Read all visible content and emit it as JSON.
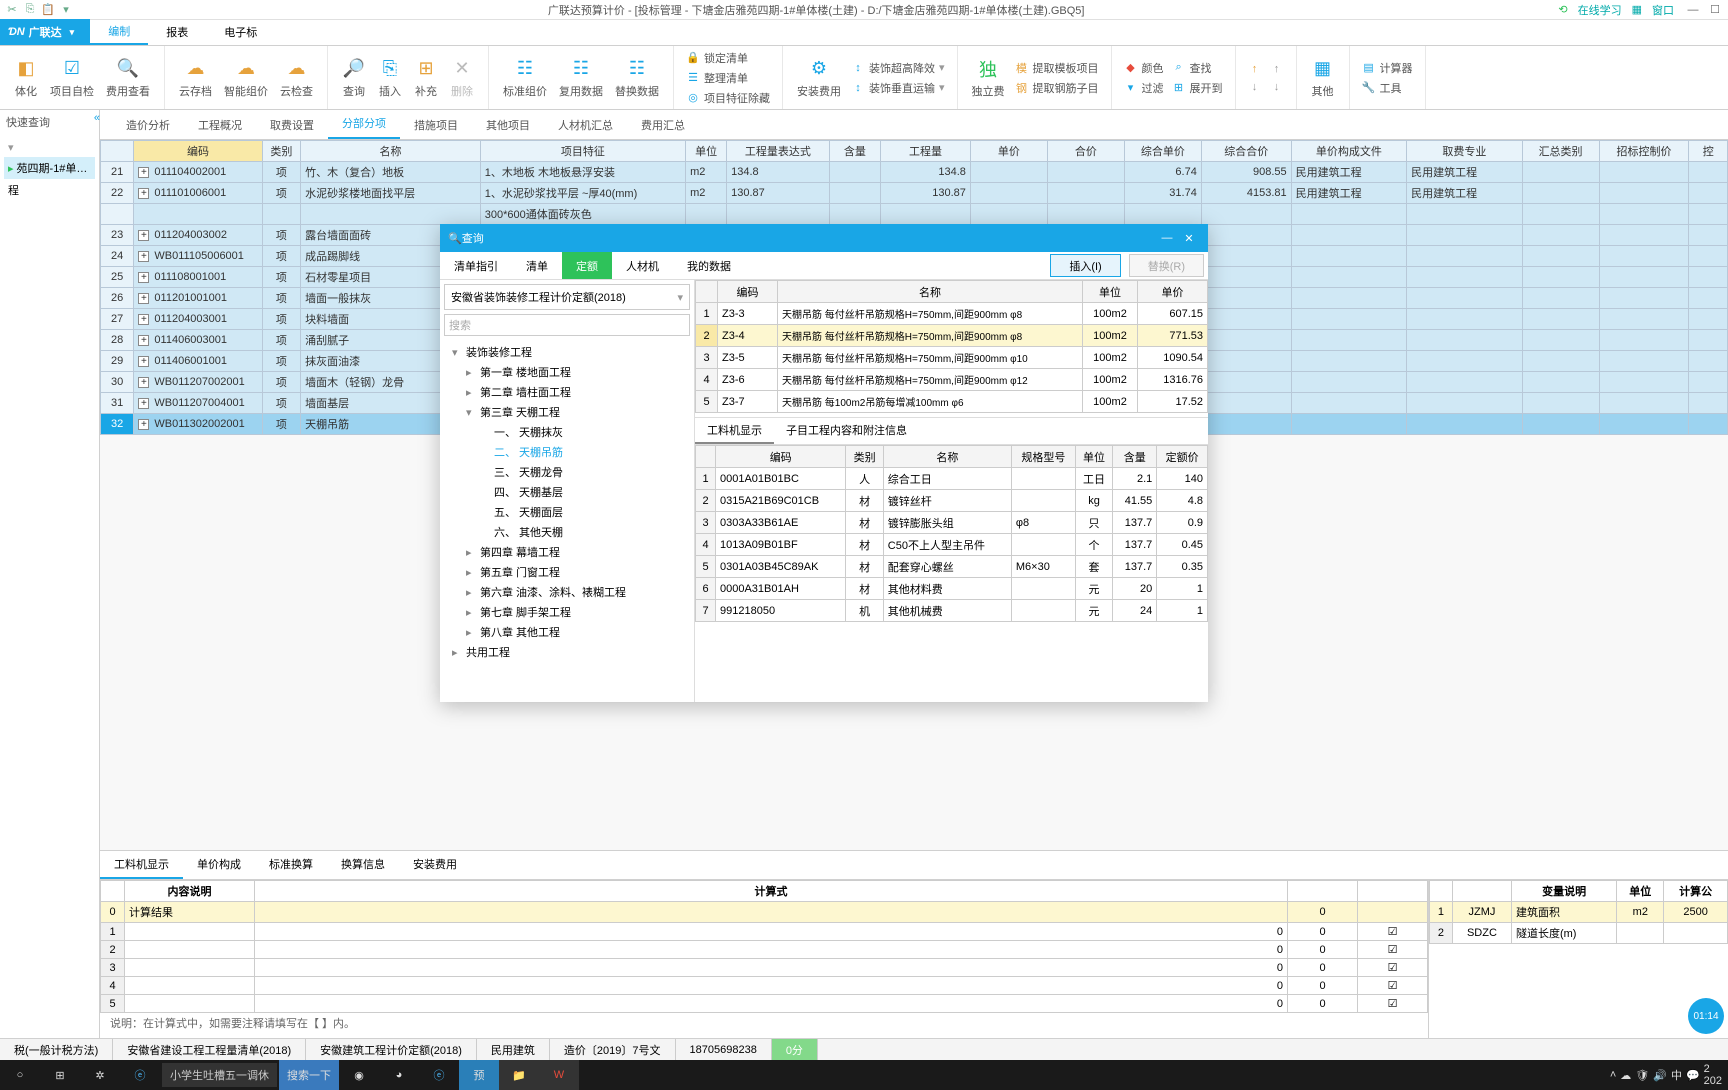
{
  "titlebar": {
    "title": "广联达预算计价 - [投标管理 - 下塘金店雅苑四期-1#单体楼(土建) - D:/下塘金店雅苑四期-1#单体楼(土建).GBQ5]",
    "online_study": "在线学习",
    "window": "窗口"
  },
  "brand": "广联达",
  "menus": [
    "编制",
    "报表",
    "电子标"
  ],
  "menu_active": 0,
  "ribbon_big": [
    {
      "label": "体化"
    },
    {
      "label": "项目自检"
    },
    {
      "label": "费用查看"
    },
    {
      "label": "云存档"
    },
    {
      "label": "智能组价"
    },
    {
      "label": "云检查"
    },
    {
      "label": "查询"
    },
    {
      "label": "插入"
    },
    {
      "label": "补充"
    },
    {
      "label": "删除",
      "disabled": true
    },
    {
      "label": "标准组价"
    },
    {
      "label": "复用数据"
    },
    {
      "label": "替换数据"
    },
    {
      "label": ""
    },
    {
      "label": "安装费用"
    },
    {
      "label": ""
    },
    {
      "label": "独立费"
    },
    {
      "label": ""
    },
    {
      "label": ""
    },
    {
      "label": ""
    },
    {
      "label": ""
    },
    {
      "label": "其他"
    },
    {
      "label": ""
    }
  ],
  "ribbon_stack1": [
    "锁定清单",
    "整理清单",
    "项目特征除藏"
  ],
  "ribbon_stack2": [
    "装饰超高降效",
    "装饰垂直运输"
  ],
  "ribbon_stack3": [
    "提取模板项目",
    "提取钢筋子目"
  ],
  "ribbon_stack4": [
    "颜色",
    "过滤"
  ],
  "ribbon_stack4b": [
    "查找",
    "展开到"
  ],
  "ribbon_stack5": [
    "计算器",
    "工具"
  ],
  "left_panel": {
    "header": "快速查询",
    "items": [
      "苑四期-1#单…",
      "程"
    ]
  },
  "nav_tabs": [
    "造价分析",
    "工程概况",
    "取费设置",
    "分部分项",
    "措施项目",
    "其他项目",
    "人材机汇总",
    "费用汇总"
  ],
  "nav_active": 3,
  "main_cols": [
    "",
    "编码",
    "类别",
    "名称",
    "项目特征",
    "单位",
    "工程量表达式",
    "含量",
    "工程量",
    "单价",
    "合价",
    "综合单价",
    "综合合价",
    "单价构成文件",
    "取费专业",
    "汇总类别",
    "招标控制价",
    "控"
  ],
  "rows": [
    {
      "n": "21",
      "code": "011104002001",
      "cat": "项",
      "name": "竹、木（复合）地板",
      "feat": "1、木地板 木地板悬浮安装",
      "unit": "m2",
      "expr": "134.8",
      "qty": "134.8",
      "up": "",
      "tot": "",
      "zup": "6.74",
      "ztot": "908.55",
      "file": "民用建筑工程",
      "spec": "民用建筑工程"
    },
    {
      "n": "22",
      "code": "011101006001",
      "cat": "项",
      "name": "水泥砂浆楼地面找平层",
      "feat": "1、水泥砂浆找平层 ~厚40(mm)",
      "unit": "m2",
      "expr": "130.87",
      "qty": "130.87",
      "up": "",
      "tot": "",
      "zup": "31.74",
      "ztot": "4153.81",
      "file": "民用建筑工程",
      "spec": "民用建筑工程"
    },
    {
      "n": "",
      "code": "",
      "cat": "",
      "name": "",
      "feat": "300*600通体面砖灰色",
      "unit": "",
      "expr": "",
      "qty": "",
      "up": "",
      "tot": "",
      "zup": "",
      "ztot": "",
      "file": "",
      "spec": ""
    },
    {
      "n": "23",
      "code": "011204003002",
      "cat": "项",
      "name": "露台墙面面砖",
      "feat": "",
      "unit": "",
      "expr": "",
      "qty": "",
      "up": "",
      "tot": "",
      "zup": "",
      "ztot": "",
      "file": "",
      "spec": ""
    },
    {
      "n": "24",
      "code": "WB011105006001",
      "cat": "项",
      "name": "成品踢脚线",
      "feat": "",
      "unit": "",
      "expr": "",
      "qty": "",
      "up": "",
      "tot": "",
      "zup": "",
      "ztot": "",
      "file": "",
      "spec": ""
    },
    {
      "n": "25",
      "code": "011108001001",
      "cat": "项",
      "name": "石材零星项目",
      "feat": "",
      "unit": "",
      "expr": "",
      "qty": "",
      "up": "",
      "tot": "",
      "zup": "",
      "ztot": "",
      "file": "",
      "spec": ""
    },
    {
      "n": "26",
      "code": "011201001001",
      "cat": "项",
      "name": "墙面一般抹灰",
      "feat": "",
      "unit": "",
      "expr": "",
      "qty": "",
      "up": "",
      "tot": "",
      "zup": "",
      "ztot": "",
      "file": "",
      "spec": ""
    },
    {
      "n": "27",
      "code": "011204003001",
      "cat": "项",
      "name": "块料墙面",
      "feat": "",
      "unit": "",
      "expr": "",
      "qty": "",
      "up": "",
      "tot": "",
      "zup": "",
      "ztot": "",
      "file": "",
      "spec": ""
    },
    {
      "n": "28",
      "code": "011406003001",
      "cat": "项",
      "name": "涌刮腻子",
      "feat": "",
      "unit": "",
      "expr": "",
      "qty": "",
      "up": "",
      "tot": "",
      "zup": "",
      "ztot": "",
      "file": "",
      "spec": ""
    },
    {
      "n": "29",
      "code": "011406001001",
      "cat": "项",
      "name": "抹灰面油漆",
      "feat": "",
      "unit": "",
      "expr": "",
      "qty": "",
      "up": "",
      "tot": "",
      "zup": "",
      "ztot": "",
      "file": "",
      "spec": ""
    },
    {
      "n": "30",
      "code": "WB011207002001",
      "cat": "项",
      "name": "墙面木（轻钢）龙骨",
      "feat": "",
      "unit": "",
      "expr": "",
      "qty": "",
      "up": "",
      "tot": "",
      "zup": "",
      "ztot": "",
      "file": "",
      "spec": ""
    },
    {
      "n": "31",
      "code": "WB011207004001",
      "cat": "项",
      "name": "墙面基层",
      "feat": "",
      "unit": "",
      "expr": "",
      "qty": "",
      "up": "",
      "tot": "",
      "zup": "",
      "ztot": "",
      "file": "",
      "spec": ""
    },
    {
      "n": "32",
      "code": "WB011302002001",
      "cat": "项",
      "name": "天棚吊筋",
      "feat": "",
      "unit": "",
      "expr": "",
      "qty": "",
      "up": "",
      "tot": "",
      "zup": "",
      "ztot": "",
      "file": "",
      "spec": "",
      "sel": true
    }
  ],
  "bottom_tabs": [
    "工料机显示",
    "单价构成",
    "标准换算",
    "换算信息",
    "安装费用"
  ],
  "calc_cols": [
    "",
    "内容说明",
    "计算式",
    "",
    ""
  ],
  "calc_rows": [
    {
      "n": "0",
      "a": "计算结果",
      "b": "",
      "c": "0",
      "d": "",
      "yell": true
    },
    {
      "n": "1",
      "a": "",
      "b": "0",
      "c": "0",
      "d": "☑"
    },
    {
      "n": "2",
      "a": "",
      "b": "0",
      "c": "0",
      "d": "☑"
    },
    {
      "n": "3",
      "a": "",
      "b": "0",
      "c": "0",
      "d": "☑"
    },
    {
      "n": "4",
      "a": "",
      "b": "0",
      "c": "0",
      "d": "☑"
    },
    {
      "n": "5",
      "a": "",
      "b": "0",
      "c": "0",
      "d": "☑"
    }
  ],
  "hint": "说明：在计算式中，如需要注释请填写在【 】内。",
  "vars_cols": [
    "",
    "",
    "变量说明",
    "单位",
    "计算公"
  ],
  "vars_rows": [
    {
      "n": "1",
      "code": "JZMJ",
      "desc": "建筑面积",
      "unit": "m2",
      "val": "2500"
    },
    {
      "n": "2",
      "code": "SDZC",
      "desc": "隧道长度(m)",
      "unit": "",
      "val": ""
    }
  ],
  "statusbar": [
    "税(一般计税方法)",
    "安徽省建设工程工程量清单(2018)",
    "安徽建筑工程计价定额(2018)",
    "民用建筑",
    "造价〔2019〕7号文",
    "18705698238"
  ],
  "status_score": "0分",
  "dialog": {
    "title": "查询",
    "tabs": [
      "清单指引",
      "清单",
      "定额",
      "人材机",
      "我的数据"
    ],
    "tab_active": 2,
    "insert_btn": "插入(I)",
    "replace_btn": "替换(R)",
    "norm_sel": "安徽省装饰装修工程计价定额(2018)",
    "search_ph": "搜索",
    "tree": [
      {
        "pad": 0,
        "exp": "▾",
        "label": "装饰装修工程"
      },
      {
        "pad": 14,
        "exp": "▸",
        "label": "第一章 楼地面工程"
      },
      {
        "pad": 14,
        "exp": "▸",
        "label": "第二章 墙柱面工程"
      },
      {
        "pad": 14,
        "exp": "▾",
        "label": "第三章 天棚工程"
      },
      {
        "pad": 28,
        "exp": "",
        "label": "一、 天棚抹灰"
      },
      {
        "pad": 28,
        "exp": "",
        "label": "二、 天棚吊筋",
        "active": true
      },
      {
        "pad": 28,
        "exp": "",
        "label": "三、 天棚龙骨"
      },
      {
        "pad": 28,
        "exp": "",
        "label": "四、 天棚基层"
      },
      {
        "pad": 28,
        "exp": "",
        "label": "五、 天棚面层"
      },
      {
        "pad": 28,
        "exp": "",
        "label": "六、 其他天棚"
      },
      {
        "pad": 14,
        "exp": "▸",
        "label": "第四章 幕墙工程"
      },
      {
        "pad": 14,
        "exp": "▸",
        "label": "第五章 门窗工程"
      },
      {
        "pad": 14,
        "exp": "▸",
        "label": "第六章 油漆、涂料、裱糊工程"
      },
      {
        "pad": 14,
        "exp": "▸",
        "label": "第七章 脚手架工程"
      },
      {
        "pad": 14,
        "exp": "▸",
        "label": "第八章 其他工程"
      },
      {
        "pad": 0,
        "exp": "▸",
        "label": "共用工程"
      }
    ],
    "list_cols": [
      "",
      "编码",
      "名称",
      "单位",
      "单价"
    ],
    "list": [
      {
        "n": "1",
        "code": "Z3-3",
        "name": "天棚吊筋 每付丝杆吊筋规格H=750mm,间距900mm φ8",
        "unit": "100m2",
        "price": "607.15"
      },
      {
        "n": "2",
        "code": "Z3-4",
        "name": "天棚吊筋 每付丝杆吊筋规格H=750mm,间距900mm φ8",
        "unit": "100m2",
        "price": "771.53",
        "sel": true
      },
      {
        "n": "3",
        "code": "Z3-5",
        "name": "天棚吊筋 每付丝杆吊筋规格H=750mm,间距900mm φ10",
        "unit": "100m2",
        "price": "1090.54"
      },
      {
        "n": "4",
        "code": "Z3-6",
        "name": "天棚吊筋 每付丝杆吊筋规格H=750mm,间距900mm φ12",
        "unit": "100m2",
        "price": "1316.76"
      },
      {
        "n": "5",
        "code": "Z3-7",
        "name": "天棚吊筋 每100m2吊筋每增减100mm φ6",
        "unit": "100m2",
        "price": "17.52"
      }
    ],
    "sub_tabs": [
      "工料机显示",
      "子目工程内容和附注信息"
    ],
    "det_cols": [
      "",
      "编码",
      "类别",
      "名称",
      "规格型号",
      "单位",
      "含量",
      "定额价"
    ],
    "details": [
      {
        "n": "1",
        "code": "0001A01B01BC",
        "cat": "人",
        "name": "综合工日",
        "spec": "",
        "unit": "工日",
        "qty": "2.1",
        "price": "140"
      },
      {
        "n": "2",
        "code": "0315A21B69C01CB",
        "cat": "材",
        "name": "镀锌丝杆",
        "spec": "",
        "unit": "kg",
        "qty": "41.55",
        "price": "4.8"
      },
      {
        "n": "3",
        "code": "0303A33B61AE",
        "cat": "材",
        "name": "镀锌膨胀头组",
        "spec": "φ8",
        "unit": "只",
        "qty": "137.7",
        "price": "0.9"
      },
      {
        "n": "4",
        "code": "1013A09B01BF",
        "cat": "材",
        "name": "C50不上人型主吊件",
        "spec": "",
        "unit": "个",
        "qty": "137.7",
        "price": "0.45"
      },
      {
        "n": "5",
        "code": "0301A03B45C89AK",
        "cat": "材",
        "name": "配套穿心螺丝",
        "spec": "M6×30",
        "unit": "套",
        "qty": "137.7",
        "price": "0.35"
      },
      {
        "n": "6",
        "code": "0000A31B01AH",
        "cat": "材",
        "name": "其他材料费",
        "spec": "",
        "unit": "元",
        "qty": "20",
        "price": "1"
      },
      {
        "n": "7",
        "code": "991218050",
        "cat": "机",
        "name": "其他机械费",
        "spec": "",
        "unit": "元",
        "qty": "24",
        "price": "1"
      }
    ]
  },
  "taskbar": {
    "search": "小学生吐槽五一调休",
    "search_btn": "搜索一下"
  },
  "time_badge": "01:14"
}
